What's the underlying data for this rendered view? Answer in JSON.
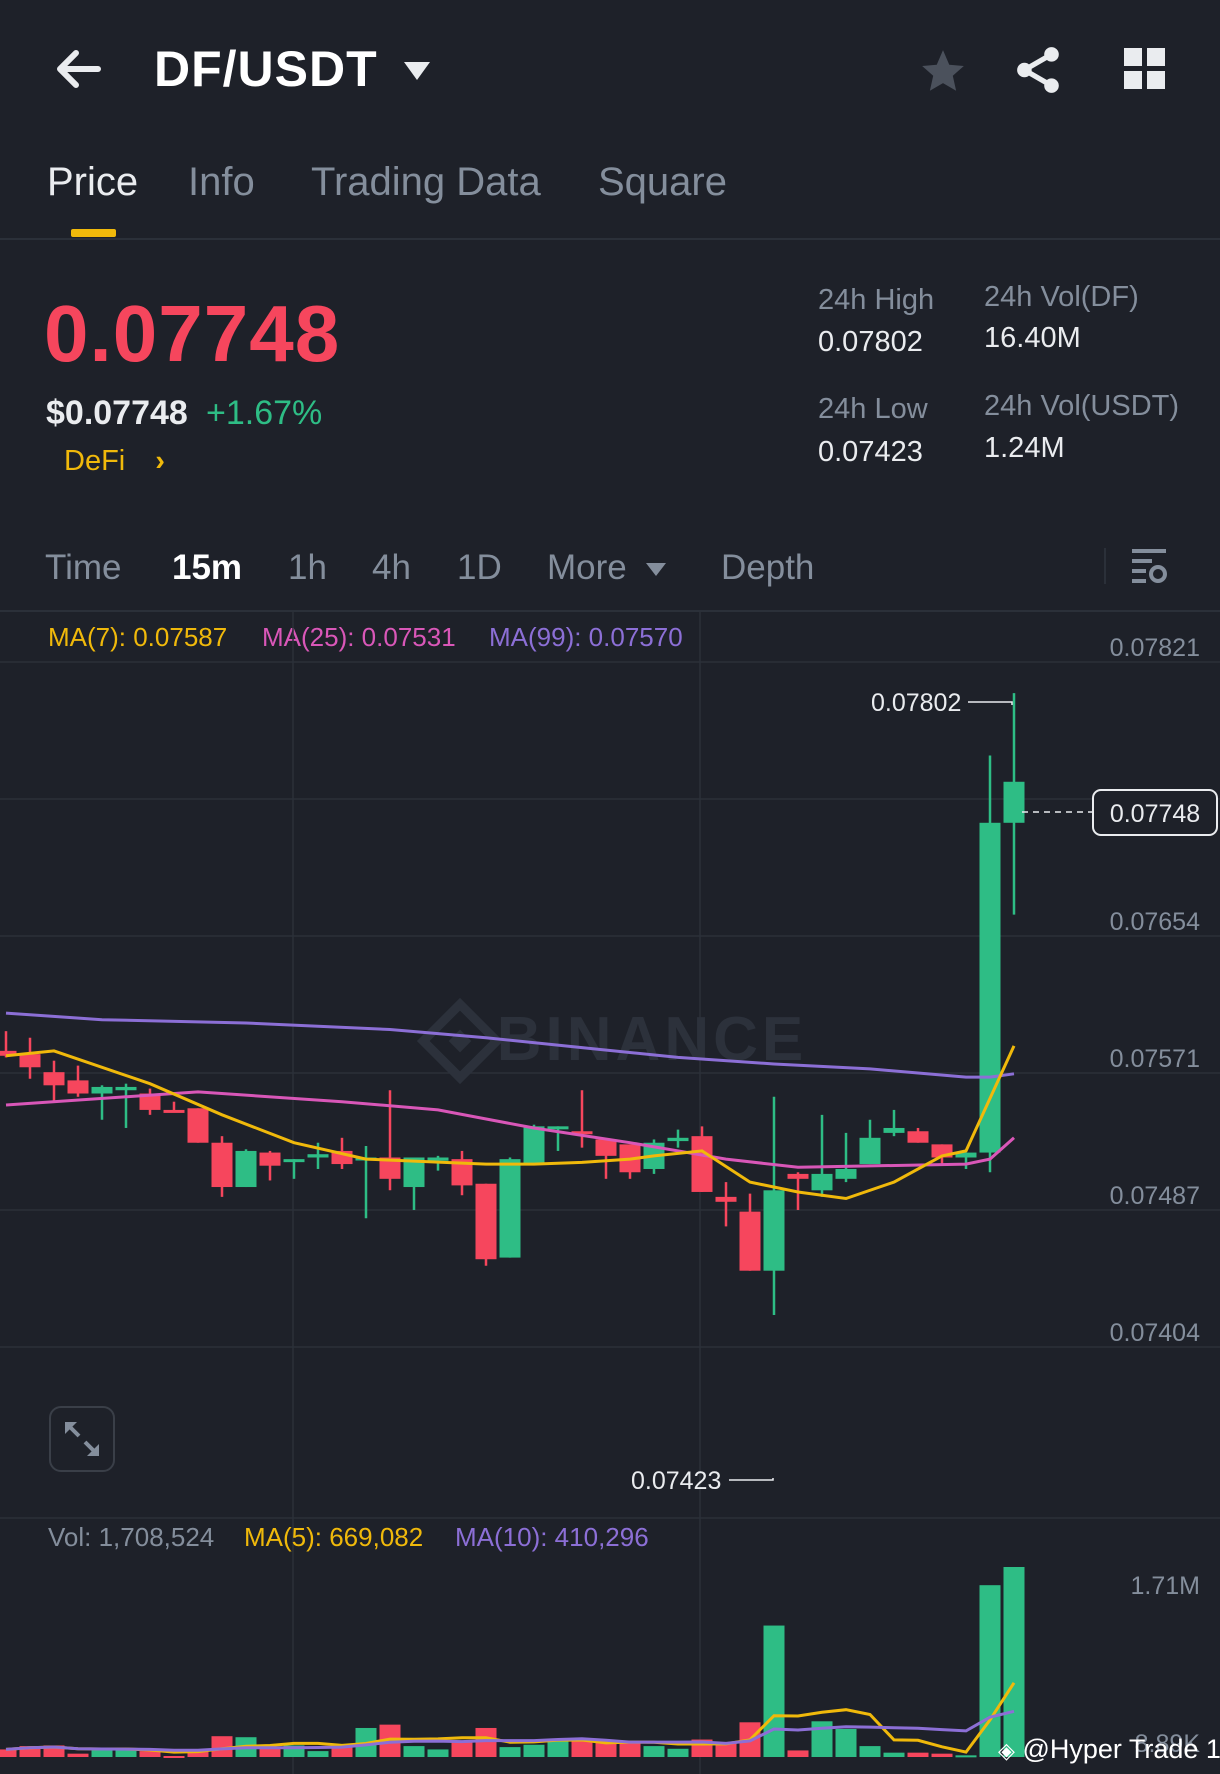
{
  "header": {
    "title": "DF/USDT",
    "icons": [
      "back-arrow-icon",
      "caret-down-icon",
      "star-icon",
      "share-icon",
      "grid-icon"
    ]
  },
  "tabs": [
    {
      "label": "Price",
      "active": true
    },
    {
      "label": "Info"
    },
    {
      "label": "Trading Data"
    },
    {
      "label": "Square"
    }
  ],
  "ticker": {
    "last_price": "0.07748",
    "usd_price": "$0.07748",
    "change": "+1.67%",
    "tag": "DeFi",
    "tag_chevron": "›",
    "stats": {
      "high_label": "24h High",
      "high_value": "0.07802",
      "low_label": "24h Low",
      "low_value": "0.07423",
      "vol_base_label": "24h Vol(DF)",
      "vol_base_value": "16.40M",
      "vol_quote_label": "24h Vol(USDT)",
      "vol_quote_value": "1.24M"
    }
  },
  "intervals": {
    "time": "Time",
    "i15m": "15m",
    "i1h": "1h",
    "i4h": "4h",
    "i1d": "1D",
    "more": "More",
    "depth": "Depth",
    "selected": "15m"
  },
  "colors": {
    "up": "#2ebd85",
    "down": "#f6465d",
    "ma7": "#f0b90b",
    "ma25": "#d957b8",
    "ma99": "#8c6fd6",
    "accent": "#f0b90b"
  },
  "indicators": {
    "ma7": "MA(7): 0.07587",
    "ma25": "MA(25): 0.07531",
    "ma99": "MA(99): 0.07570"
  },
  "volume_legend": {
    "vol": "Vol: 1,708,524",
    "ma5": "MA(5): 669,082",
    "ma10": "MA(10): 410,296"
  },
  "watermark": "BINANCE",
  "credit": "@Hyper Trade 1",
  "chart_data": {
    "type": "candlestick",
    "interval": "15m",
    "price_axis": {
      "ticks": [
        "0.07821",
        "0.07654",
        "0.07571",
        "0.07487",
        "0.07404"
      ],
      "range": [
        0.074035,
        0.07821
      ]
    },
    "volume_axis": {
      "ticks": [
        "1.71M",
        "8.89K"
      ],
      "max": 1708524
    },
    "high_marker": "0.07802",
    "low_marker": "0.07423",
    "current_price": "0.07748",
    "candles_ohlc": [
      [
        0.07584,
        0.07596,
        0.0758,
        0.07581
      ],
      [
        0.07582,
        0.07592,
        0.07567,
        0.07574
      ],
      [
        0.07571,
        0.07578,
        0.07553,
        0.07563
      ],
      [
        0.07566,
        0.07575,
        0.07556,
        0.07558
      ],
      [
        0.07558,
        0.07563,
        0.07542,
        0.07562
      ],
      [
        0.0756,
        0.07564,
        0.07537,
        0.07562
      ],
      [
        0.07558,
        0.07561,
        0.07545,
        0.07548
      ],
      [
        0.07548,
        0.07553,
        0.07547,
        0.07547
      ],
      [
        0.07549,
        0.07549,
        0.07528,
        0.07528
      ],
      [
        0.07528,
        0.07532,
        0.07495,
        0.07501
      ],
      [
        0.07501,
        0.07524,
        0.07501,
        0.07523
      ],
      [
        0.07522,
        0.07523,
        0.07505,
        0.07514
      ],
      [
        0.07517,
        0.07518,
        0.07506,
        0.07518
      ],
      [
        0.07519,
        0.07528,
        0.07512,
        0.07521
      ],
      [
        0.07523,
        0.07531,
        0.07512,
        0.07515
      ],
      [
        0.07518,
        0.07526,
        0.07482,
        0.07519
      ],
      [
        0.07519,
        0.0756,
        0.07499,
        0.07506
      ],
      [
        0.07501,
        0.07519,
        0.07487,
        0.07519
      ],
      [
        0.07517,
        0.0752,
        0.07511,
        0.07519
      ],
      [
        0.07518,
        0.07523,
        0.07496,
        0.07502
      ],
      [
        0.07503,
        0.07503,
        0.07453,
        0.07457
      ],
      [
        0.07458,
        0.07519,
        0.07458,
        0.07518
      ],
      [
        0.07515,
        0.07539,
        0.07515,
        0.07538
      ],
      [
        0.07537,
        0.07538,
        0.07523,
        0.07538
      ],
      [
        0.07535,
        0.0756,
        0.07525,
        0.07534
      ],
      [
        0.0753,
        0.0753,
        0.07506,
        0.0752
      ],
      [
        0.07527,
        0.07527,
        0.07506,
        0.0751
      ],
      [
        0.07512,
        0.0753,
        0.07509,
        0.07528
      ],
      [
        0.07529,
        0.07536,
        0.07525,
        0.07531
      ],
      [
        0.07532,
        0.07538,
        0.07498,
        0.07498
      ],
      [
        0.07495,
        0.07504,
        0.07477,
        0.07492
      ],
      [
        0.07486,
        0.07497,
        0.0745,
        0.0745
      ],
      [
        0.0745,
        0.07556,
        0.07423,
        0.07499
      ],
      [
        0.07509,
        0.0751,
        0.07487,
        0.07506
      ],
      [
        0.07499,
        0.07545,
        0.07495,
        0.07509
      ],
      [
        0.07506,
        0.07534,
        0.07504,
        0.07512
      ],
      [
        0.07515,
        0.07542,
        0.07515,
        0.07531
      ],
      [
        0.07534,
        0.07548,
        0.07532,
        0.07537
      ],
      [
        0.07535,
        0.07537,
        0.07528,
        0.07528
      ],
      [
        0.07527,
        0.07527,
        0.07514,
        0.07519
      ],
      [
        0.07519,
        0.07522,
        0.07512,
        0.07522
      ],
      [
        0.07522,
        0.07764,
        0.0751,
        0.07723
      ],
      [
        0.07723,
        0.07802,
        0.07667,
        0.07748
      ]
    ],
    "volumes": [
      68000,
      98000,
      104000,
      30000,
      59000,
      68000,
      53000,
      9000,
      53000,
      187000,
      178000,
      89000,
      104000,
      53000,
      98000,
      261000,
      291000,
      98000,
      68000,
      149000,
      261000,
      89000,
      110000,
      149000,
      157000,
      128000,
      128000,
      98000,
      74000,
      157000,
      134000,
      312000,
      1182000,
      59000,
      321000,
      252000,
      98000,
      39000,
      39000,
      30000,
      15000,
      1545000,
      1708524
    ],
    "ma7": [
      [
        0,
        0.07581
      ],
      [
        2,
        0.07584
      ],
      [
        6,
        0.07564
      ],
      [
        9,
        0.07545
      ],
      [
        12,
        0.07528
      ],
      [
        15,
        0.07518
      ],
      [
        20,
        0.07515
      ],
      [
        22,
        0.07515
      ],
      [
        24,
        0.07516
      ],
      [
        26,
        0.07518
      ],
      [
        27,
        0.0752
      ],
      [
        29,
        0.07523
      ],
      [
        31,
        0.07504
      ],
      [
        33,
        0.07498
      ],
      [
        35,
        0.07494
      ],
      [
        37,
        0.07504
      ],
      [
        39,
        0.0752
      ],
      [
        40,
        0.07523
      ],
      [
        42,
        0.07587
      ]
    ],
    "ma25": [
      [
        0,
        0.07551
      ],
      [
        8,
        0.07559
      ],
      [
        14,
        0.07553
      ],
      [
        18,
        0.07548
      ],
      [
        22,
        0.07537
      ],
      [
        26,
        0.07528
      ],
      [
        30,
        0.07518
      ],
      [
        33,
        0.07513
      ],
      [
        40,
        0.07515
      ],
      [
        41,
        0.07518
      ],
      [
        42,
        0.07531
      ]
    ],
    "ma99": [
      [
        0,
        0.07607
      ],
      [
        4,
        0.07603
      ],
      [
        10,
        0.07601
      ],
      [
        16,
        0.07597
      ],
      [
        20,
        0.07592
      ],
      [
        24,
        0.07586
      ],
      [
        28,
        0.0758
      ],
      [
        32,
        0.07576
      ],
      [
        36,
        0.07573
      ],
      [
        40,
        0.07568
      ],
      [
        41,
        0.07568
      ],
      [
        42,
        0.0757
      ]
    ]
  }
}
